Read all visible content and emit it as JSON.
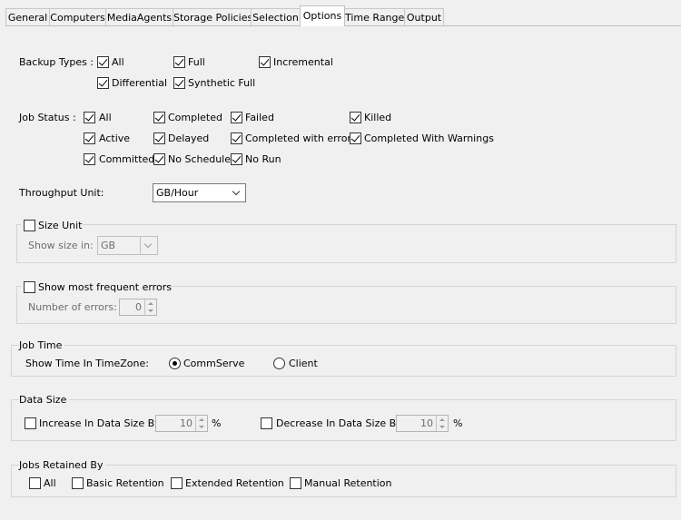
{
  "tabs": [
    "General",
    "Computers",
    "MediaAgents",
    "Storage Policies",
    "Selection",
    "Options",
    "Time Range",
    "Output"
  ],
  "backup_types": {
    "label": "Backup Types :",
    "options": [
      {
        "label": "All",
        "checked": true
      },
      {
        "label": "Full",
        "checked": true
      },
      {
        "label": "Incremental",
        "checked": true
      },
      {
        "label": "Differential",
        "checked": true
      },
      {
        "label": "Synthetic Full",
        "checked": true
      }
    ]
  },
  "job_status": {
    "label": "Job Status :",
    "options": [
      {
        "label": "All",
        "checked": true
      },
      {
        "label": "Completed",
        "checked": true
      },
      {
        "label": "Failed",
        "checked": true
      },
      {
        "label": "Killed",
        "checked": true
      },
      {
        "label": "Active",
        "checked": true
      },
      {
        "label": "Delayed",
        "checked": true
      },
      {
        "label": "Completed with errors",
        "checked": true
      },
      {
        "label": "Completed With Warnings",
        "checked": true
      },
      {
        "label": "Committed",
        "checked": true
      },
      {
        "label": "No Schedule",
        "checked": true
      },
      {
        "label": "No Run",
        "checked": true
      }
    ]
  },
  "throughput": {
    "label": "Throughput Unit:",
    "value": "GB/Hour"
  },
  "size_unit": {
    "label": "Size Unit",
    "checked": false,
    "show_label": "Show size in:",
    "value": "GB"
  },
  "frequent_errors": {
    "label": "Show most frequent errors",
    "checked": false,
    "count_label": "Number of errors:",
    "count": "0"
  },
  "job_time": {
    "title": "Job Time",
    "label": "Show Time In TimeZone:",
    "options": [
      {
        "label": "CommServe",
        "selected": true
      },
      {
        "label": "Client",
        "selected": false
      }
    ]
  },
  "data_size": {
    "title": "Data Size",
    "increase": {
      "label": "Increase In Data Size By",
      "checked": false,
      "value": "10",
      "unit": "%"
    },
    "decrease": {
      "label": "Decrease In Data Size By",
      "checked": false,
      "value": "10",
      "unit": "%"
    }
  },
  "jobs_retained": {
    "title": "Jobs Retained By",
    "options": [
      {
        "label": "All",
        "checked": false
      },
      {
        "label": "Basic Retention",
        "checked": false
      },
      {
        "label": "Extended Retention",
        "checked": false
      },
      {
        "label": "Manual Retention",
        "checked": false
      }
    ]
  }
}
